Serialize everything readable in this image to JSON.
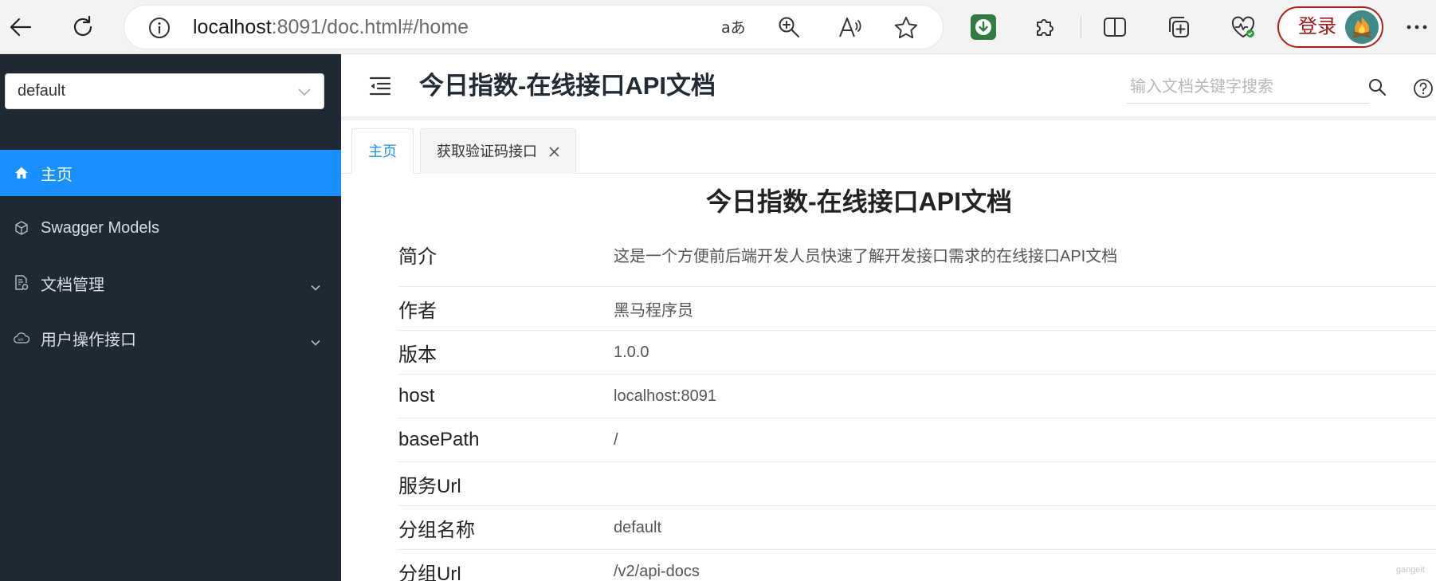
{
  "browser": {
    "url_host": "localhost",
    "url_rest": ":8091/doc.html#/home",
    "login_label": "登录"
  },
  "sidebar": {
    "group_select": "default",
    "items": [
      {
        "label": "主页",
        "active": true,
        "icon": "home-icon"
      },
      {
        "label": "Swagger Models",
        "active": false,
        "icon": "cube-icon"
      },
      {
        "label": "文档管理",
        "active": false,
        "icon": "doc-gear-icon",
        "expandable": true
      },
      {
        "label": "用户操作接口",
        "active": false,
        "icon": "cloud-api-icon",
        "expandable": true
      }
    ]
  },
  "header": {
    "title": "今日指数-在线接口API文档",
    "search_placeholder": "输入文档关键字搜索"
  },
  "tabs": [
    {
      "label": "主页",
      "active": true
    },
    {
      "label": "获取验证码接口",
      "active": false,
      "closable": true
    }
  ],
  "doc": {
    "title": "今日指数-在线接口API文档",
    "rows": [
      {
        "key": "简介",
        "value": "这是一个方便前后端开发人员快速了解开发接口需求的在线接口API文档"
      },
      {
        "key": "作者",
        "value": "黑马程序员"
      },
      {
        "key": "版本",
        "value": "1.0.0"
      },
      {
        "key": "host",
        "value": "localhost:8091"
      },
      {
        "key": "basePath",
        "value": "/"
      },
      {
        "key": "服务Url",
        "value": ""
      },
      {
        "key": "分组名称",
        "value": "default"
      },
      {
        "key": "分组Url",
        "value": "/v2/api-docs"
      }
    ]
  },
  "watermark": "gangeit",
  "colors": {
    "sidebar_bg": "#1f2933",
    "accent": "#1890ff",
    "login_border": "#b01e1e"
  }
}
